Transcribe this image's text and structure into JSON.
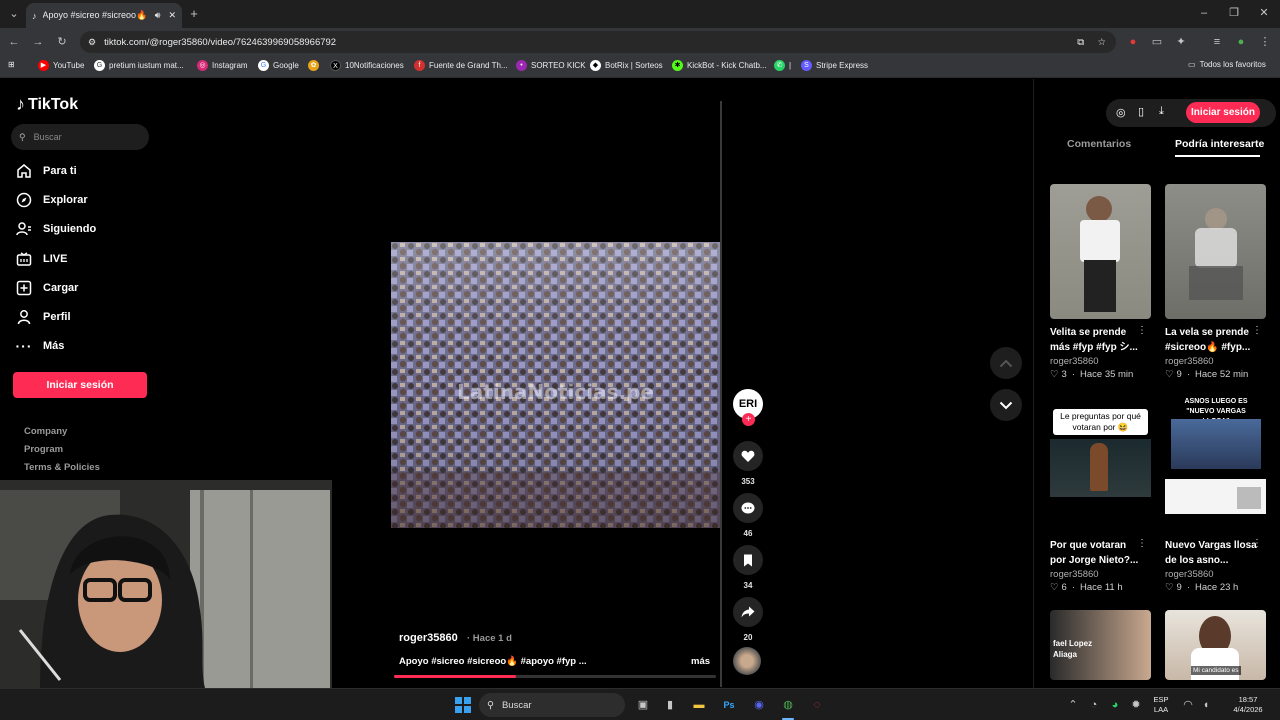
{
  "browser": {
    "tab_title": "Apoyo #sicreo #sicreoo🔥",
    "url": "tiktok.com/@roger35860/video/7624639969058966792",
    "bookmarks": [
      {
        "label": "YouTube",
        "color": "#ff0000"
      },
      {
        "label": "pretium iustum mat...",
        "color": "#ffffff"
      },
      {
        "label": "Instagram",
        "color": "#d62976"
      },
      {
        "label": "Google",
        "color": "#ffffff"
      },
      {
        "label": "",
        "color": "#e8a317"
      },
      {
        "label": "10Notificaciones",
        "color": "#000000"
      },
      {
        "label": "Fuente de Grand Th...",
        "color": "#d32f2f"
      },
      {
        "label": "SORTEO KICK",
        "color": "#9c27b0"
      },
      {
        "label": "BotRix | Sorteos",
        "color": "#ffffff"
      },
      {
        "label": "KickBot - Kick Chatb...",
        "color": "#53fc18"
      },
      {
        "label": "|",
        "color": "#25d366"
      },
      {
        "label": "Stripe Express",
        "color": "#635bff"
      }
    ],
    "all_bookmarks": "Todos los favoritos"
  },
  "sidebar": {
    "logo": "TikTok",
    "search_placeholder": "Buscar",
    "items": [
      {
        "label": "Para ti",
        "icon": "home-icon"
      },
      {
        "label": "Explorar",
        "icon": "compass-icon"
      },
      {
        "label": "Siguiendo",
        "icon": "following-icon"
      },
      {
        "label": "LIVE",
        "icon": "live-icon"
      },
      {
        "label": "Cargar",
        "icon": "upload-icon"
      },
      {
        "label": "Perfil",
        "icon": "profile-icon"
      },
      {
        "label": "Más",
        "icon": "more-icon"
      }
    ],
    "login_label": "Iniciar sesión",
    "footer": [
      "Company",
      "Program",
      "Terms & Policies"
    ]
  },
  "video": {
    "watermark": "LatinaNoticias.pe",
    "author": "roger35860",
    "time": "· Hace 1 d",
    "caption": "Apoyo #sicreo #sicreoo🔥 #apoyo #fyp ...",
    "more": "más",
    "progress": 0.38,
    "avatar_text": "ERI",
    "likes": "353",
    "comments": "46",
    "saves": "34",
    "shares": "20"
  },
  "right_panel": {
    "login_label": "Iniciar sesión",
    "tabs": [
      "Comentarios",
      "Podría interesarte"
    ],
    "cards": [
      {
        "title": "Velita se prende más #fyp #fyp シ...",
        "user": "roger35860",
        "likes": "3",
        "time": "Hace 35 min"
      },
      {
        "title": "La vela se prende #sicreoo🔥 #fyp...",
        "user": "roger35860",
        "likes": "9",
        "time": "Hace 52 min"
      },
      {
        "title": "Por que votaran por Jorge Nieto?...",
        "user": "roger35860",
        "likes": "6",
        "time": "Hace 11 h",
        "overlay": "Le preguntas por qué votaran por 😆"
      },
      {
        "title": "Nuevo Vargas llosa de los asno...",
        "user": "roger35860",
        "likes": "9",
        "time": "Hace 23 h",
        "overlay": "ASNOS LUEGO ES \"NUEVO VARGAS LLOSA\""
      },
      {
        "title": "",
        "user": "",
        "likes": "",
        "time": "",
        "overlay": "fael Lopez Aliaga"
      },
      {
        "title": "",
        "user": "",
        "likes": "",
        "time": "",
        "overlay": "Mi candidato es"
      }
    ]
  },
  "taskbar": {
    "search_label": "Buscar",
    "lang": "ESP",
    "lang2": "LAA",
    "time": "18:57",
    "date": "4/4/2026"
  }
}
